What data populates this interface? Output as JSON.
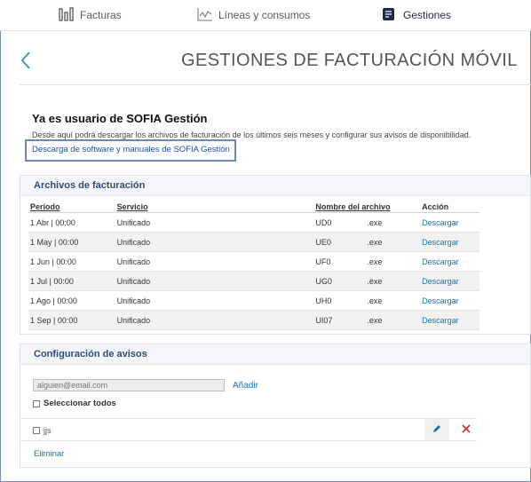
{
  "nav": {
    "tabs": [
      {
        "label": "Facturas",
        "icon": "bar-chart-icon"
      },
      {
        "label": "Líneas y consumos",
        "icon": "line-chart-icon"
      },
      {
        "label": "Gestiones",
        "icon": "document-edit-icon"
      }
    ],
    "active": "Gestiones"
  },
  "header": {
    "title": "GESTIONES DE FACTURACIÓN MÓVIL",
    "back_icon": "chevron-left-icon"
  },
  "intro": {
    "title": "Ya es usuario de SOFIA Gestión",
    "description": "Desde aquí podrá descargar los archivos de facturación de los últimos seis meses y configurar sus avisos de disponibilidad.",
    "download_link": "Descarga de software y manuales de SOFIA Gestión"
  },
  "archivos": {
    "title": "Archivos de facturación",
    "columns": [
      "Período",
      "Servicio",
      "Nombre del archivo",
      "Acción"
    ],
    "rows": [
      {
        "periodo": "1 Abr | 00:00",
        "servicio": "Unificado",
        "archivo_prefix": "UD0",
        "archivo_ext": ".exe",
        "accion": "Descargar"
      },
      {
        "periodo": "1 May | 00:00",
        "servicio": "Unificado",
        "archivo_prefix": "UE0",
        "archivo_ext": ".exe",
        "accion": "Descargar"
      },
      {
        "periodo": "1 Jun | 00:00",
        "servicio": "Unificado",
        "archivo_prefix": "UF0",
        "archivo_ext": ".exe",
        "accion": "Descargar"
      },
      {
        "periodo": "1 Jul | 00:00",
        "servicio": "Unificado",
        "archivo_prefix": "UG0",
        "archivo_ext": ".exe",
        "accion": "Descargar"
      },
      {
        "periodo": "1 Ago | 00:00",
        "servicio": "Unificado",
        "archivo_prefix": "UH0",
        "archivo_ext": ".exe",
        "accion": "Descargar"
      },
      {
        "periodo": "1 Sep | 00:00",
        "servicio": "Unificado",
        "archivo_prefix": "UI07",
        "archivo_ext": ".exe",
        "accion": "Descargar"
      }
    ]
  },
  "avisos": {
    "title": "Configuración de avisos",
    "email_placeholder": "alguien@email.com",
    "add_label": "Añadir",
    "select_all_label": "Seleccionar todos",
    "items": [
      {
        "label": "jjs"
      }
    ],
    "delete_label": "Eliminar"
  },
  "colors": {
    "link": "#1f6fb5",
    "panel_title": "#2b4b80",
    "delete_icon": "#d0343f",
    "edit_icon": "#1f6fb5"
  }
}
